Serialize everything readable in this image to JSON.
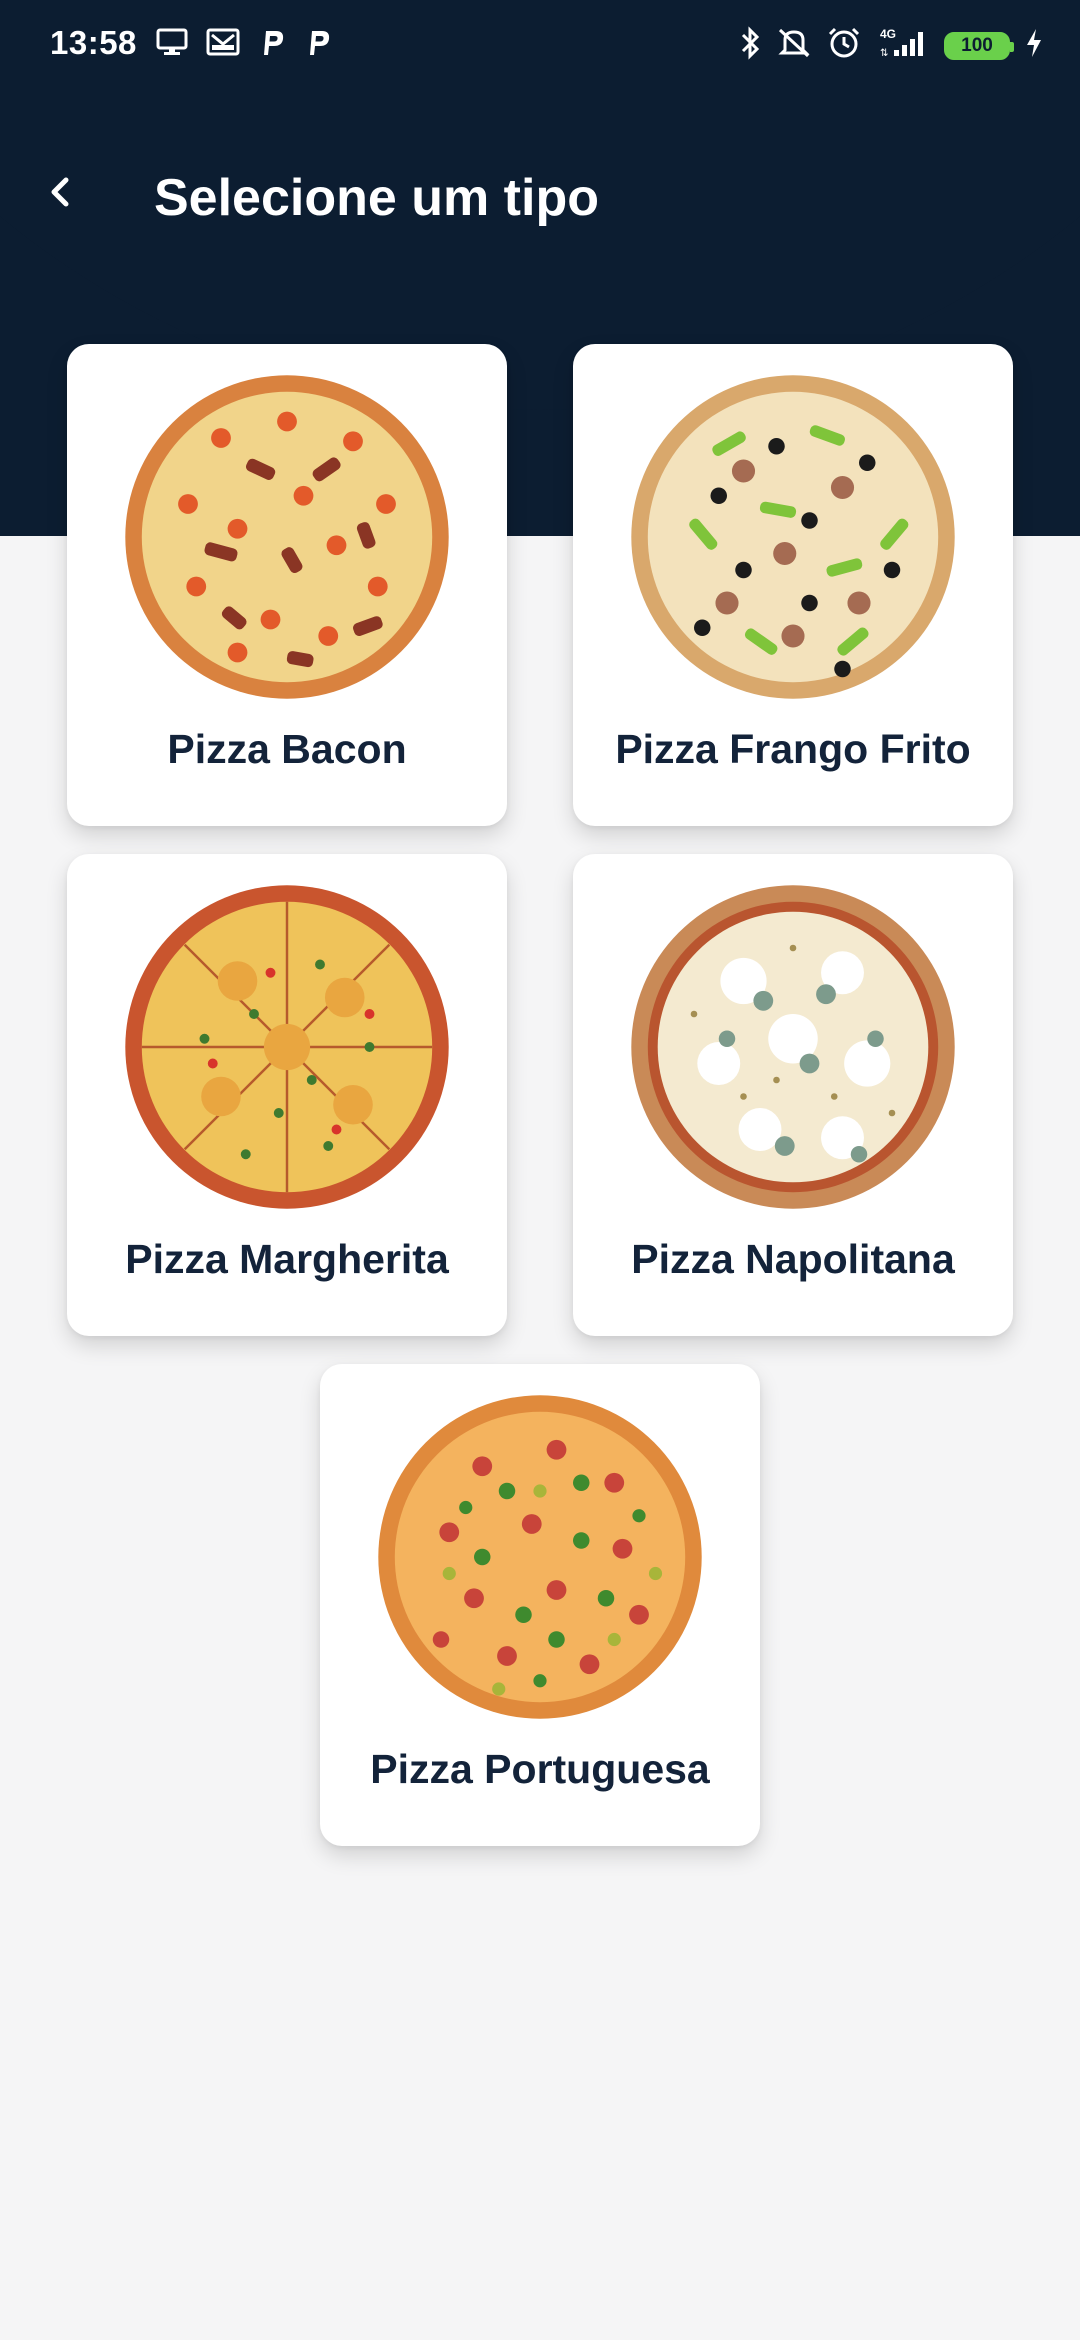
{
  "status_bar": {
    "time": "13:58",
    "left_icons": [
      "screen-cast-icon",
      "gmail-icon",
      "parking-p-icon",
      "parking-p-icon"
    ],
    "right_icons": [
      "bluetooth-icon",
      "silent-mode-icon",
      "alarm-icon",
      "signal-4g-icon"
    ],
    "network": "4G",
    "battery_level": "100",
    "charging": true
  },
  "appbar": {
    "title": "Selecione um tipo",
    "back_icon": "chevron-left-icon"
  },
  "colors": {
    "header": "#0c1d31",
    "background": "#f5f5f6",
    "card": "#ffffff",
    "label": "#13233a",
    "battery": "#6ad04b"
  },
  "pizzas": [
    {
      "label": "Pizza Bacon",
      "image": "pizza-bacon-image"
    },
    {
      "label": "Pizza Frango Frito",
      "image": "pizza-frango-frito-image"
    },
    {
      "label": "Pizza Margherita",
      "image": "pizza-margherita-image"
    },
    {
      "label": "Pizza Napolitana",
      "image": "pizza-napolitana-image"
    },
    {
      "label": "Pizza Portuguesa",
      "image": "pizza-portuguesa-image"
    }
  ]
}
